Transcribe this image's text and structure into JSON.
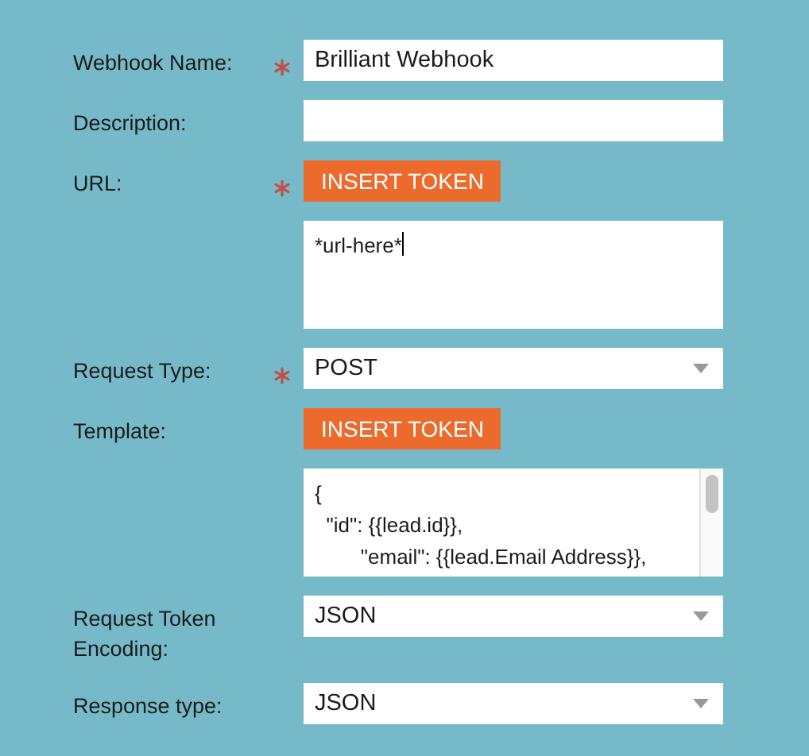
{
  "fields": [
    {
      "kind": "text",
      "label": "Webhook Name:",
      "required": true,
      "value": "Brilliant Webhook"
    },
    {
      "kind": "text",
      "label": "Description:",
      "required": false
    },
    {
      "kind": "token",
      "label": "URL:",
      "required": true,
      "button": "INSERT TOKEN",
      "value": "*url-here*",
      "caret": true,
      "scrollbar": false
    },
    {
      "kind": "select",
      "label": "Request Type:",
      "required": true,
      "value": "POST"
    },
    {
      "kind": "token",
      "label": "Template:",
      "required": false,
      "button": "INSERT TOKEN",
      "value": "{\n  \"id\": {{lead.id}},\n        \"email\": {{lead.Email Address}},",
      "caret": false,
      "scrollbar": true
    },
    {
      "kind": "select",
      "label": "Request Token Encoding:",
      "required": false,
      "value": "JSON"
    },
    {
      "kind": "select",
      "label": "Response type:",
      "required": false,
      "value": "JSON"
    }
  ]
}
